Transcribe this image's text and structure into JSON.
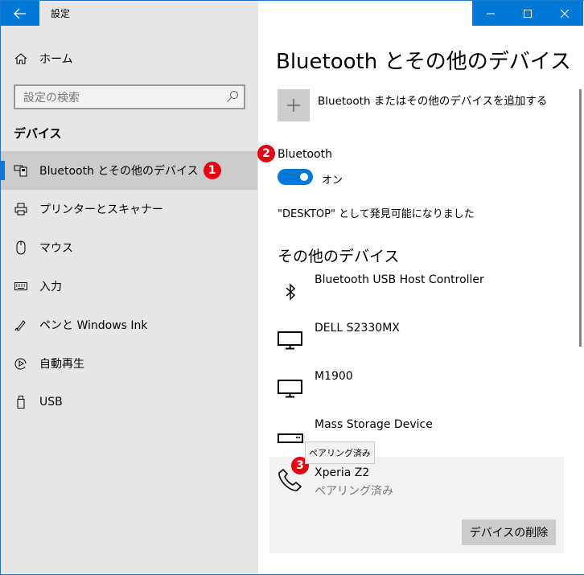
{
  "window": {
    "title": "設定",
    "controls": {
      "minimize": "minimize-icon",
      "maximize": "maximize-icon",
      "close": "close-icon"
    }
  },
  "sidebar": {
    "home_label": "ホーム",
    "search_placeholder": "設定の検索",
    "section_title": "デバイス",
    "items": [
      {
        "label": "Bluetooth とその他のデバイス",
        "icon": "bluetooth-devices-icon",
        "active": true,
        "badge": "1"
      },
      {
        "label": "プリンターとスキャナー",
        "icon": "printer-icon"
      },
      {
        "label": "マウス",
        "icon": "mouse-icon"
      },
      {
        "label": "入力",
        "icon": "keyboard-icon"
      },
      {
        "label": "ペンと Windows Ink",
        "icon": "pen-icon"
      },
      {
        "label": "自動再生",
        "icon": "autoplay-icon"
      },
      {
        "label": "USB",
        "icon": "usb-icon"
      }
    ]
  },
  "main": {
    "page_title": "Bluetooth とその他のデバイス",
    "add_device_label": "Bluetooth またはその他のデバイスを追加する",
    "bluetooth": {
      "label": "Bluetooth",
      "badge": "2",
      "toggle_state": "オン",
      "on": true,
      "discoverable_text": "\"DESKTOP\" として発見可能になりました"
    },
    "other_devices": {
      "title": "その他のデバイス",
      "devices": [
        {
          "name": "Bluetooth USB Host Controller",
          "icon": "bluetooth-icon"
        },
        {
          "name": "DELL S2330MX",
          "icon": "monitor-icon"
        },
        {
          "name": "M1900",
          "icon": "monitor-icon"
        },
        {
          "name": "Mass Storage Device",
          "icon": "storage-icon"
        },
        {
          "name": "Xperia Z2",
          "status": "ペアリング済み",
          "icon": "phone-icon",
          "selected": true,
          "badge": "3"
        }
      ]
    },
    "tooltip": "ペアリング済み",
    "remove_button": "デバイスの削除"
  },
  "colors": {
    "accent": "#0078d7",
    "badge": "#e60012",
    "sidebar_bg": "#e6e6e6"
  }
}
